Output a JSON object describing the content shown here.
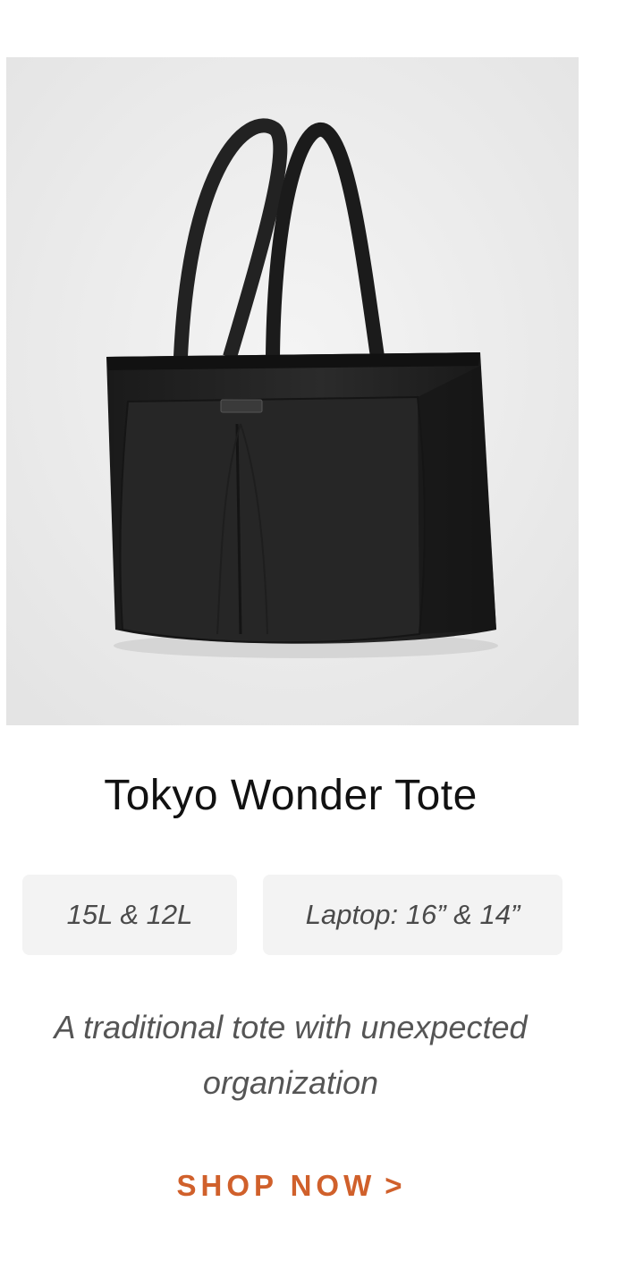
{
  "product": {
    "image_alt": "Tokyo Wonder Tote",
    "title": "Tokyo Wonder Tote",
    "specs": {
      "capacity": "15L & 12L",
      "laptop": "Laptop: 16” & 14”"
    },
    "description_line1": "A traditional tote with unexpected",
    "description_line2": "organization",
    "cta": {
      "label": "SHOP NOW",
      "chevron": ">",
      "color": "#d0602b"
    }
  }
}
